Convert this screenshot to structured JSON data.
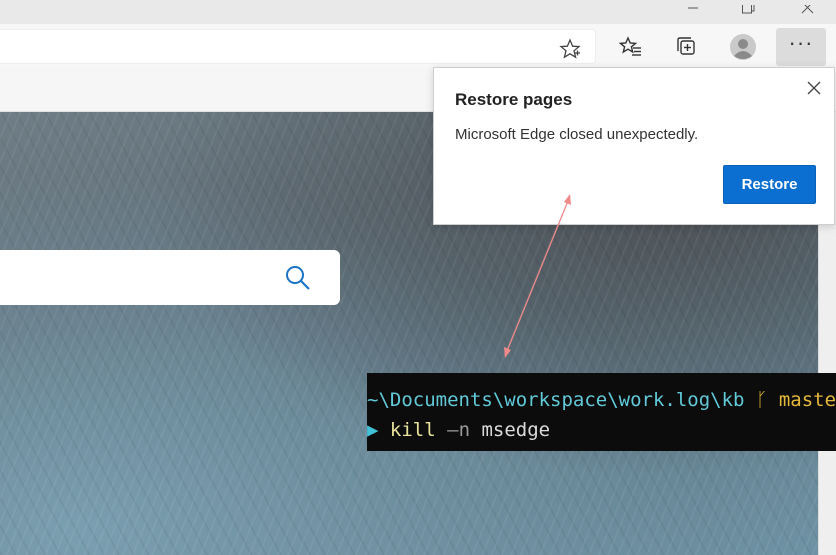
{
  "popup": {
    "title": "Restore pages",
    "message": "Microsoft Edge closed unexpectedly.",
    "restore_label": "Restore"
  },
  "toolbar": {
    "menu_label": "···"
  },
  "terminal": {
    "path": "~\\Documents\\workspace\\work.log\\kb",
    "branch_glyph": "ᚴ",
    "branch": "master",
    "prompt_glyph": "▶",
    "command": "kill",
    "flag": "–n",
    "argument": "msedge"
  },
  "icons": {
    "window": [
      "minimize-icon",
      "restore-icon",
      "close-icon"
    ],
    "toolbar": [
      "favorite-star-icon",
      "favorites-icon",
      "collections-icon",
      "profile-icon",
      "more-icon"
    ],
    "page": [
      "search-icon"
    ]
  },
  "colors": {
    "restore_button": "#0a6fd1",
    "terminal_bg": "#0c0c0c",
    "arrow": "#f07f7f"
  }
}
